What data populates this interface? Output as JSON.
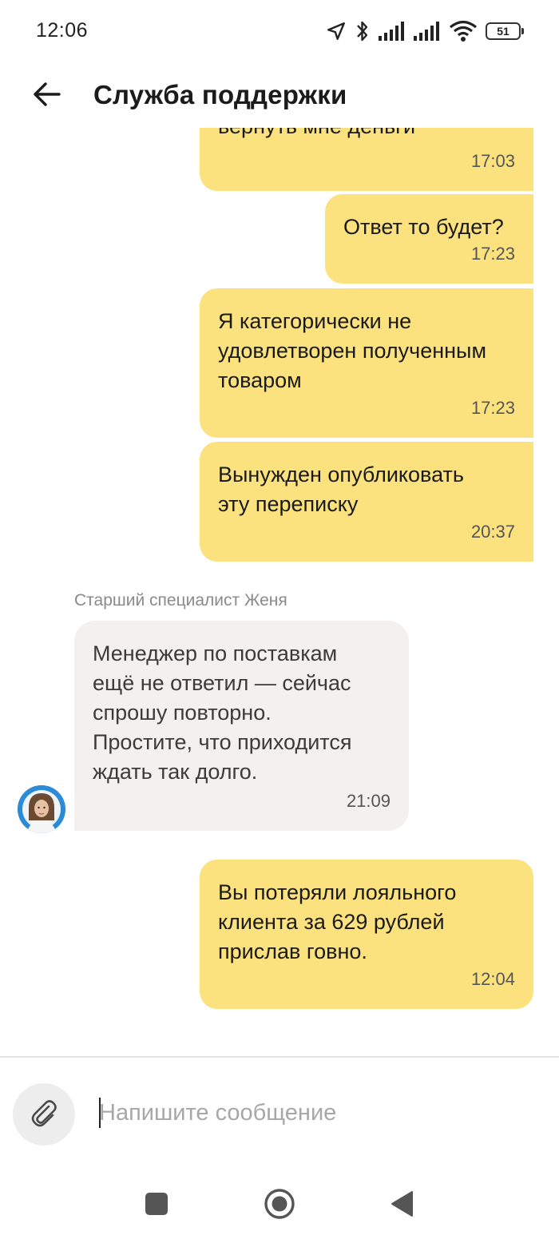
{
  "status_bar": {
    "time": "12:06",
    "battery": "51",
    "icons": [
      "location-icon",
      "bluetooth-icon",
      "signal-icon",
      "signal-icon",
      "wifi-icon",
      "battery-icon"
    ]
  },
  "header": {
    "title": "Служба поддержки",
    "back_icon": "arrow-left-icon"
  },
  "messages": [
    {
      "direction": "outgoing",
      "text": "вернуть мне деньги",
      "time": "17:03"
    },
    {
      "direction": "outgoing",
      "text": "Ответ то будет?",
      "time": "17:23"
    },
    {
      "direction": "outgoing",
      "text": "Я категорически не\nудовлетворен полученным\nтоваром",
      "time": "17:23"
    },
    {
      "direction": "outgoing",
      "text": "Вынужден опубликовать\nэту переписку",
      "time": "20:37"
    },
    {
      "direction": "incoming",
      "sender": "Старший специалист Женя",
      "text": "Менеджер по поставкам\nещё не ответил — сейчас\nспрошу повторно.\nПростите, что приходится\nждать так долго.",
      "time": "21:09"
    },
    {
      "direction": "outgoing",
      "text": "Вы потеряли лояльного\nклиента за 629 рублей\nприслав говно.",
      "time": "12:04"
    }
  ],
  "composer": {
    "placeholder": "Напишите сообщение",
    "value": "",
    "attach_icon": "paperclip-icon"
  },
  "nav_bar": {
    "items": [
      "recents-square-icon",
      "home-circle-icon",
      "back-triangle-icon"
    ]
  },
  "colors": {
    "outgoing_bubble": "#fbe27e",
    "incoming_bubble": "#f2f1f0",
    "avatar_ring": "#2c8bd6"
  }
}
